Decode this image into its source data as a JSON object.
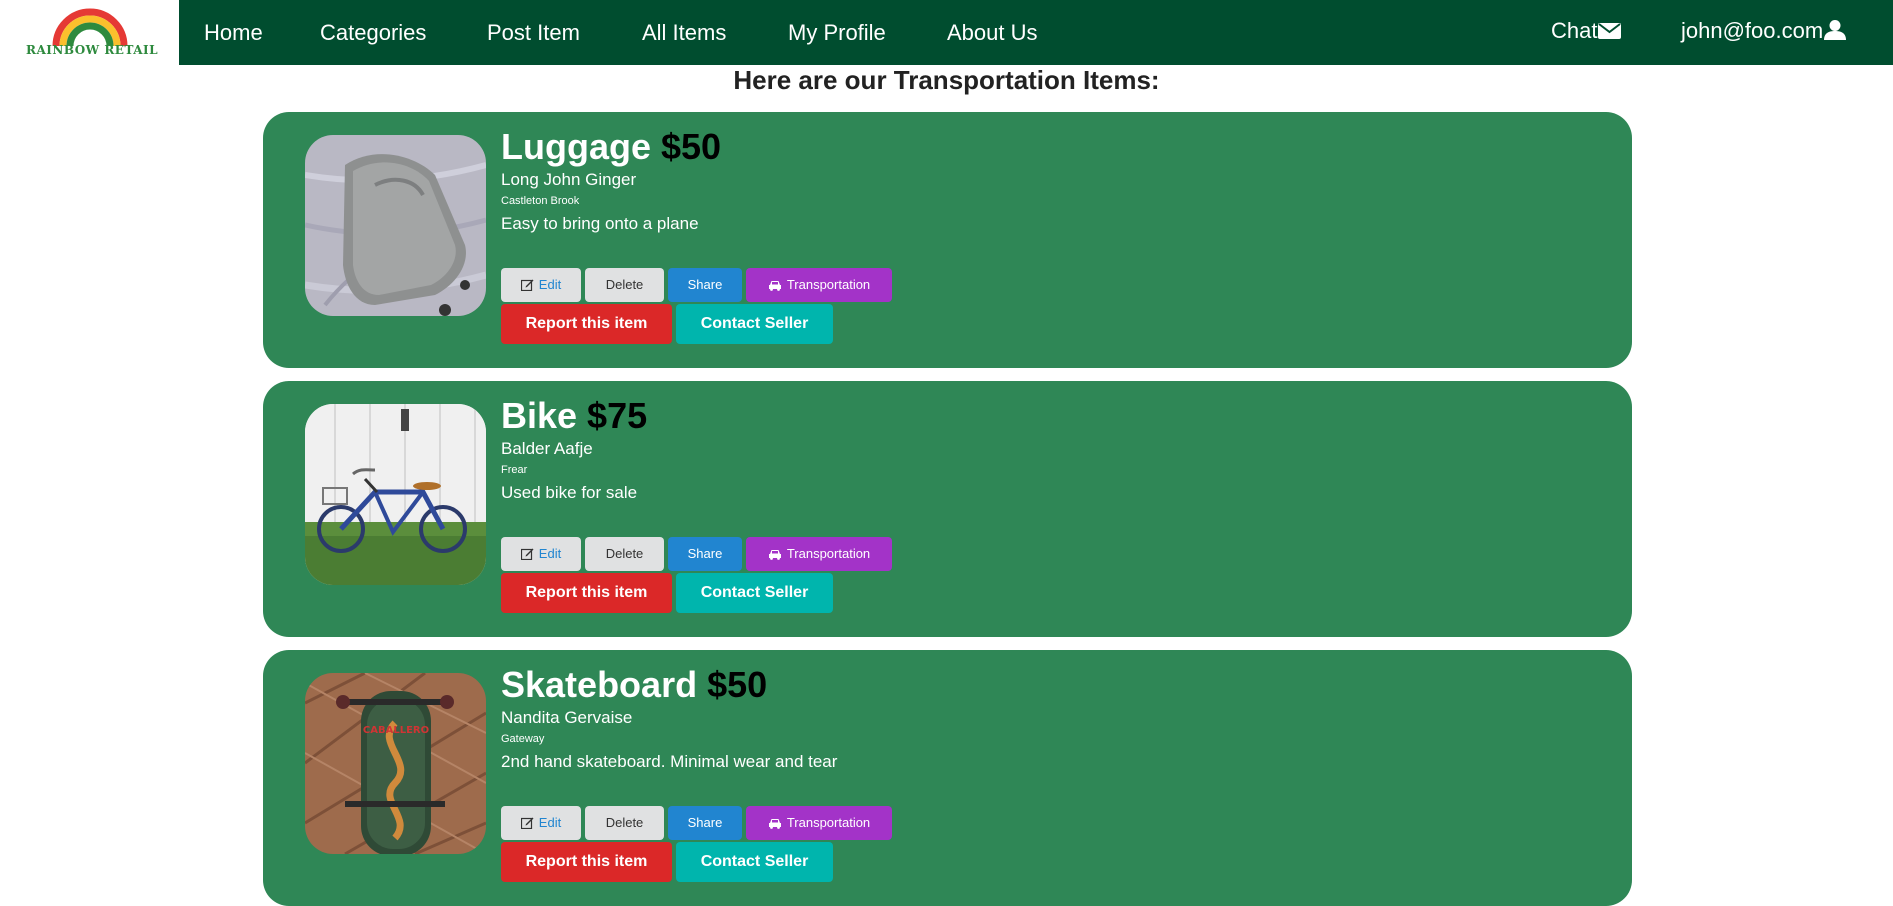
{
  "brand": {
    "logo_text": "RAINBOW RETAIL"
  },
  "nav": {
    "links": [
      "Home",
      "Categories",
      "Post Item",
      "All Items",
      "My Profile",
      "About Us"
    ],
    "chat_label": "Chat",
    "user_email": "john@foo.com"
  },
  "colors": {
    "nav_bg": "#004d2f",
    "card_bg": "#2f8756",
    "report": "#db2828",
    "contact": "#00b5ad",
    "share": "#2185d0",
    "category": "#a333c8"
  },
  "page": {
    "heading": "Here are our Transportation Items:"
  },
  "buttons": {
    "edit": "Edit",
    "delete": "Delete",
    "share": "Share",
    "report": "Report this item",
    "contact": "Contact Seller"
  },
  "items": [
    {
      "name": "Luggage",
      "price": "$50",
      "seller": "Long John Ginger",
      "location": "Castleton Brook",
      "description": "Easy to bring onto a plane",
      "category": "Transportation",
      "image": "luggage-photo"
    },
    {
      "name": "Bike",
      "price": "$75",
      "seller": "Balder Aafje",
      "location": "Frear",
      "description": "Used bike for sale",
      "category": "Transportation",
      "image": "bike-photo"
    },
    {
      "name": "Skateboard",
      "price": "$50",
      "seller": "Nandita Gervaise",
      "location": "Gateway",
      "description": "2nd hand skateboard. Minimal wear and tear",
      "category": "Transportation",
      "image": "skateboard-photo"
    }
  ]
}
